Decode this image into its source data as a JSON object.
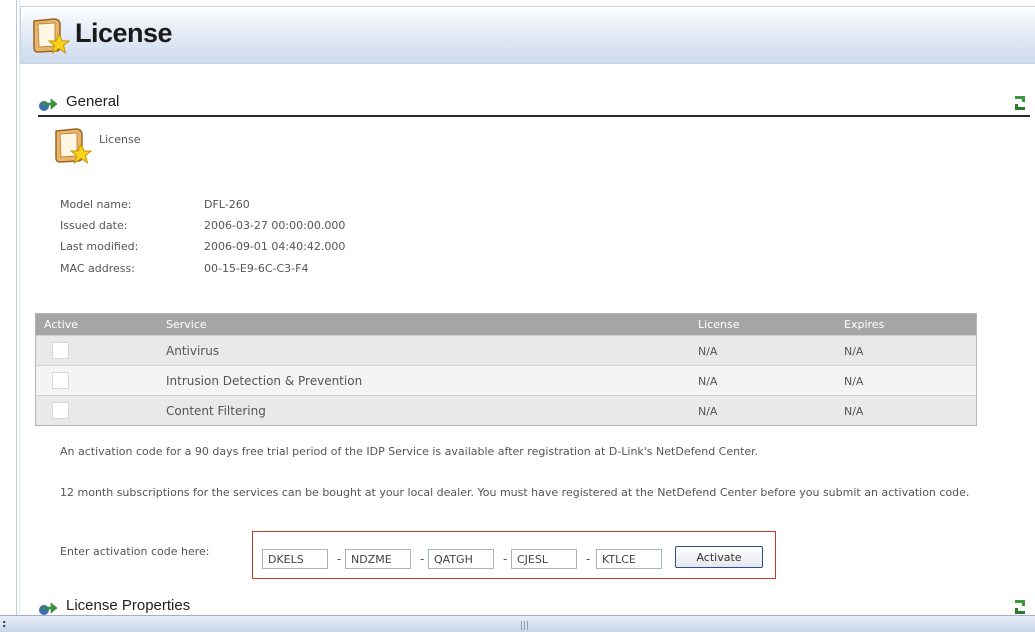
{
  "header": {
    "title": "License"
  },
  "general": {
    "heading": "General",
    "license_caption": "License",
    "info": [
      {
        "key": "Model name:",
        "value": "DFL-260"
      },
      {
        "key": "Issued date:",
        "value": "2006-03-27 00:00:00.000"
      },
      {
        "key": "Last modified:",
        "value": "2006-09-01 04:40:42.000"
      },
      {
        "key": "MAC address:",
        "value": "00-15-E9-6C-C3-F4"
      }
    ]
  },
  "services_table": {
    "columns": [
      "Active",
      "Service",
      "License",
      "Expires"
    ],
    "rows": [
      {
        "active": false,
        "service": "Antivirus",
        "license": "N/A",
        "expires": "N/A"
      },
      {
        "active": false,
        "service": "Intrusion Detection & Prevention",
        "license": "N/A",
        "expires": "N/A"
      },
      {
        "active": false,
        "service": "Content Filtering",
        "license": "N/A",
        "expires": "N/A"
      }
    ]
  },
  "notes": {
    "trial": "An activation code for a 90 days free trial period of the IDP Service is available after registration at D-Link's NetDefend Center.",
    "subscription": "12 month subscriptions for the services can be bought at your local dealer. You must have registered at the NetDefend Center before you submit an activation code."
  },
  "activation": {
    "label": "Enter activation code here:",
    "codes": [
      "DKELS",
      "NDZME",
      "QATGH",
      "CJESL",
      "KTLCE"
    ],
    "separator": "-",
    "button_label": "Activate"
  },
  "license_properties": {
    "heading": "License Properties"
  },
  "status_bar": {
    "left_glyph": ":",
    "grip": "|||"
  },
  "colors": {
    "header_gradient_bottom": "#cddaed",
    "table_header": "#a5a5a5",
    "activation_border": "#c0392b",
    "button_border": "#2a4f84",
    "arrow_green": "#3a9a3a",
    "arrow_blue": "#3d6fb0"
  },
  "icons": {
    "title": "license-certificate-icon",
    "section": "section-arrow-icon",
    "refresh": "refresh-icon"
  }
}
